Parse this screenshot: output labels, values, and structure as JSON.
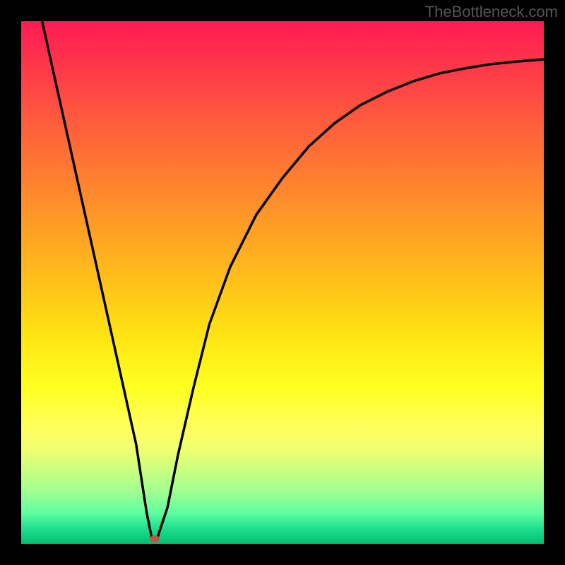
{
  "watermark": "TheBottleneck.com",
  "chart_data": {
    "type": "line",
    "title": "",
    "xlabel": "",
    "ylabel": "",
    "xlim": [
      0,
      100
    ],
    "ylim": [
      0,
      100
    ],
    "grid": false,
    "legend": false,
    "series": [
      {
        "name": "bottleneck-curve",
        "x": [
          4,
          6,
          8,
          10,
          12,
          14,
          16,
          18,
          20,
          22,
          24,
          25,
          26,
          28,
          30,
          33,
          36,
          40,
          45,
          50,
          55,
          60,
          65,
          70,
          75,
          80,
          85,
          90,
          95,
          100
        ],
        "values": [
          100,
          91,
          82,
          73,
          64,
          55,
          46,
          37,
          28,
          19,
          6,
          1,
          1,
          7,
          17,
          30,
          42,
          53,
          63,
          70,
          76,
          80.5,
          84,
          86.5,
          88.5,
          90,
          91,
          91.8,
          92.3,
          92.7
        ]
      }
    ],
    "marker": {
      "x": 25.5,
      "y": 1
    },
    "background": {
      "type": "vertical-gradient",
      "stops": [
        {
          "pos": 0,
          "color": "#ff1a54"
        },
        {
          "pos": 50,
          "color": "#ffc11a"
        },
        {
          "pos": 75,
          "color": "#ffff30"
        },
        {
          "pos": 100,
          "color": "#00c070"
        }
      ]
    }
  }
}
